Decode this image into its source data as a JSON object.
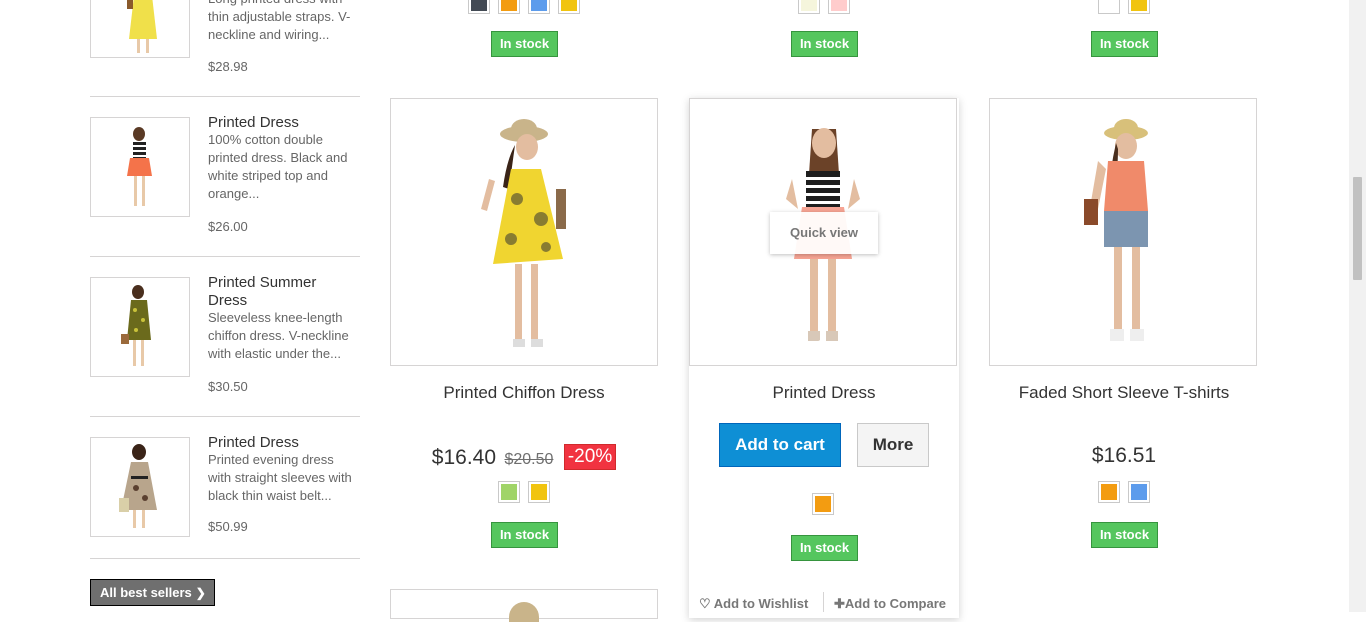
{
  "sidebar": {
    "items": [
      {
        "name": "",
        "desc": "Long printed dress with thin adjustable straps. V-neckline and wiring...",
        "desc_visible": "thin adjustable straps. V-neckline and wiring...",
        "desc_top_partial": "Long printed dress with",
        "price": "$28.98"
      },
      {
        "name": "Printed Dress",
        "desc": "100% cotton double printed dress. Black and white striped top and orange...",
        "price": "$26.00"
      },
      {
        "name": "Printed Summer Dress",
        "desc": "Sleeveless knee-length chiffon dress. V-neckline with elastic under the...",
        "price": "$30.50"
      },
      {
        "name": "Printed Dress",
        "desc": "Printed evening dress with straight sleeves with black thin waist belt...",
        "price": "$50.99"
      }
    ],
    "best_sellers_label": "All best sellers",
    "best_sellers_icon": "chevron-right-icon"
  },
  "top_row": {
    "stock_labels": [
      "In stock",
      "In stock",
      "In stock"
    ]
  },
  "products": [
    {
      "name": "Printed Chiffon Dress",
      "price": "$16.40",
      "old_price": "$20.50",
      "discount": "-20%",
      "colors": [
        "#a0d468",
        "#f1c40f"
      ],
      "stock": "In stock"
    },
    {
      "name": "Printed Dress",
      "quick_view": "Quick view",
      "add_to_cart": "Add to cart",
      "more": "More",
      "colors": [
        "#f39c11"
      ],
      "stock": "In stock",
      "wishlist": "Add to Wishlist",
      "compare": "Add to Compare"
    },
    {
      "name": "Faded Short Sleeve T-shirts",
      "price": "$16.51",
      "colors": [
        "#f39c11",
        "#5d9cec"
      ],
      "stock": "In stock"
    }
  ],
  "colors": {
    "in_stock_bg": "#55c65e",
    "cart_blue": "#0e8fd5",
    "discount_red": "#f13340"
  }
}
